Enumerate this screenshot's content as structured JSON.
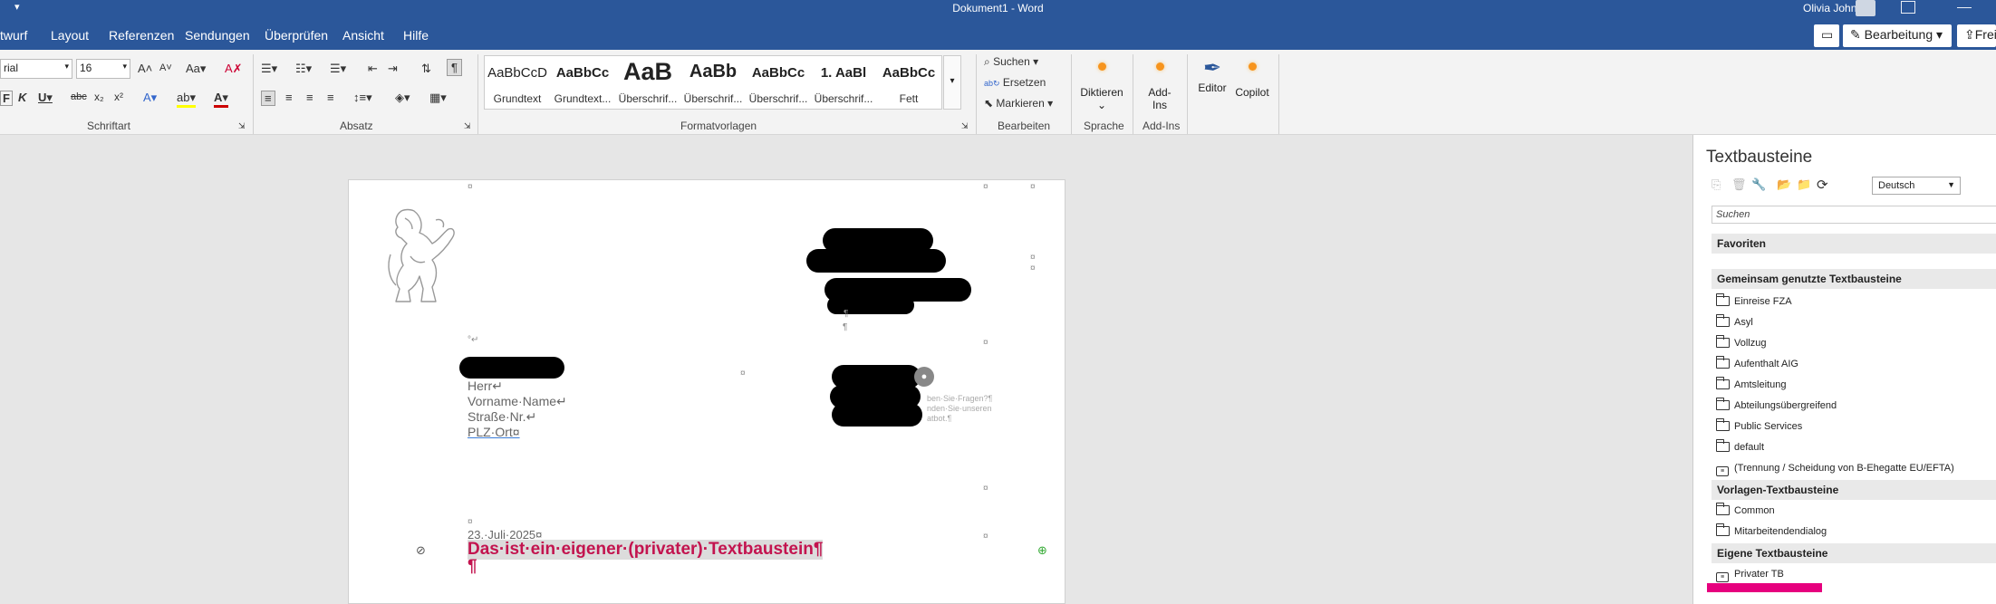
{
  "window": {
    "title": "Dokument1  -  Word",
    "user": "Olivia John"
  },
  "tabs": [
    "twurf",
    "Layout",
    "Referenzen",
    "Sendungen",
    "Überprüfen",
    "Ansicht",
    "Hilfe"
  ],
  "top_buttons": {
    "bearbeitung": "Bearbeitung",
    "freigeben": "Freig"
  },
  "font": {
    "name": "rial",
    "size": "16"
  },
  "groups": {
    "schriftart": "Schriftart",
    "absatz": "Absatz",
    "formatvorlagen": "Formatvorlagen",
    "bearbeiten": "Bearbeiten",
    "sprache": "Sprache",
    "addins": "Add-Ins"
  },
  "styles": [
    {
      "preview": "AaBbCcD",
      "name": "Grundtext"
    },
    {
      "preview": "AaBbCc",
      "name": "Grundtext..."
    },
    {
      "preview": "AaB",
      "name": "Überschrif..."
    },
    {
      "preview": "AaBb",
      "name": "Überschrif..."
    },
    {
      "preview": "AaBbCc",
      "name": "Überschrif..."
    },
    {
      "preview": "1.  AaBl",
      "name": "Überschrif..."
    },
    {
      "preview": "AaBbCc",
      "name": "Fett"
    }
  ],
  "editing": {
    "suchen": "Suchen",
    "ersetzen": "Ersetzen",
    "markieren": "Markieren"
  },
  "big": {
    "diktieren": "Diktieren",
    "addins": "Add-\nIns",
    "editor": "Editor",
    "copilot": "Copilot"
  },
  "document": {
    "address": [
      "Herr↵",
      "Vorname·Name↵",
      "Straße·Nr.↵",
      "PLZ·Ort¤"
    ],
    "date": "23.·Juli·2025¤",
    "heading": "Das·ist·ein·eigener·(privater)·Textbaustein¶",
    "heading_para": "¶",
    "side_text": [
      "ben·Sie·Fragen?¶",
      "nden·Sie·unseren",
      "atbot.¶"
    ]
  },
  "pane": {
    "title": "Textbausteine",
    "language": "Deutsch",
    "search_placeholder": "Suchen",
    "favoriten": "Favoriten",
    "gemeinsam": "Gemeinsam genutzte Textbausteine",
    "gemeinsam_items": [
      "Einreise FZA",
      "Asyl",
      "Vollzug",
      "Aufenthalt AIG",
      "Amtsleitung",
      "Abteilungsübergreifend",
      "Public Services",
      "default"
    ],
    "gemeinsam_tb": "(Trennung / Scheidung von B-Ehegatte EU/EFTA)",
    "vorlagen": "Vorlagen-Textbausteine",
    "vorlagen_items": [
      "Common",
      "Mitarbeitendendialog"
    ],
    "eigene": "Eigene Textbausteine",
    "eigene_item": "Privater TB"
  }
}
